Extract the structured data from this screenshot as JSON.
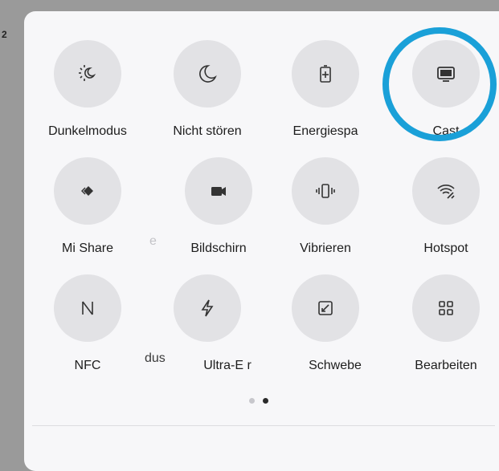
{
  "tiles": [
    {
      "label": "Dunkelmodus",
      "icon": "dark-mode-icon"
    },
    {
      "label": "Nicht stören",
      "icon": "moon-icon"
    },
    {
      "label": "Energiespa",
      "icon": "battery-icon"
    },
    {
      "label": "Cast",
      "icon": "cast-screen-icon"
    },
    {
      "label": "Mi Share",
      "icon": "mi-share-icon"
    },
    {
      "label": "Bildschirn",
      "icon": "video-camera-icon"
    },
    {
      "label": "Vibrieren",
      "icon": "vibrate-icon"
    },
    {
      "label": "Hotspot",
      "icon": "hotspot-icon"
    },
    {
      "label": "NFC",
      "icon": "nfc-icon"
    },
    {
      "label": "Ultra-E r",
      "icon": "lightning-icon"
    },
    {
      "label": "Schwebe",
      "icon": "floating-window-icon"
    },
    {
      "label": "Bearbeiten",
      "icon": "grid-edit-icon"
    }
  ],
  "ghost_labels": {
    "row2": "e",
    "row3": "dus"
  },
  "pagination": {
    "pages": 2,
    "current": 2
  },
  "colors": {
    "highlight_ring": "#1aa0d8",
    "tile_bg": "#e2e2e5",
    "panel_bg": "#f7f7f9"
  }
}
